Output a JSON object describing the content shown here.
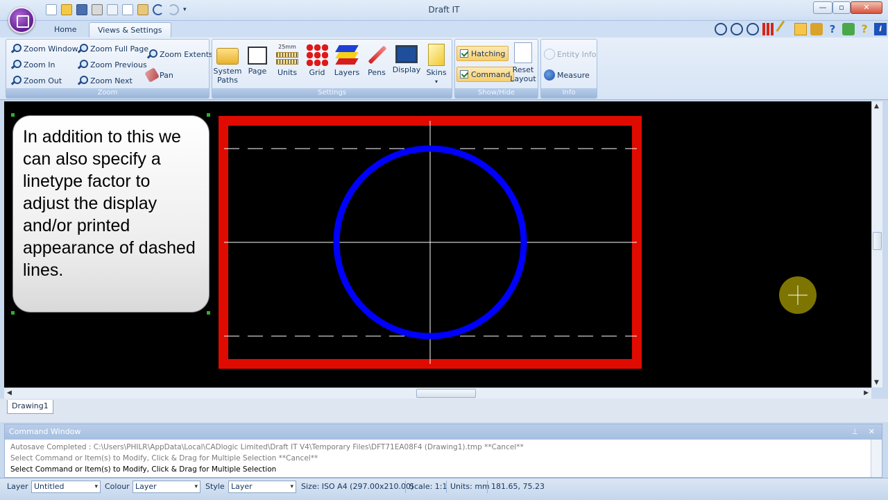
{
  "window": {
    "title": "Draft IT",
    "min_label": "—",
    "max_label": "▫",
    "close_label": "✕"
  },
  "tabs": [
    {
      "label": "Home"
    },
    {
      "label": "Views & Settings"
    }
  ],
  "ribbon": {
    "zoom": {
      "label": "Zoom",
      "zoom_window": "Zoom Window",
      "zoom_in": "Zoom In",
      "zoom_out": "Zoom Out",
      "zoom_full_page": "Zoom Full Page",
      "zoom_previous": "Zoom Previous",
      "zoom_next": "Zoom Next",
      "zoom_extents": "Zoom Extents",
      "pan": "Pan"
    },
    "settings": {
      "label": "Settings",
      "system_paths_1": "System",
      "system_paths_2": "Paths",
      "page": "Page",
      "units": "Units",
      "units_icon_text": "25mm",
      "grid": "Grid",
      "layers": "Layers",
      "pens": "Pens",
      "display": "Display",
      "skins": "Skins"
    },
    "showhide": {
      "label": "Show/Hide",
      "hatching": "Hatching",
      "command": "Command",
      "reset_1": "Reset",
      "reset_2": "Layout"
    },
    "info": {
      "label": "Info",
      "entity_info": "Entity Info",
      "measure": "Measure"
    }
  },
  "callout": {
    "text": "In addition to this we can also specify a linetype factor to adjust the display and/or printed appearance of dashed lines."
  },
  "drawing": {
    "frame_color": "#e00b00",
    "circle_color": "#0000ff",
    "line_color": "#ffffff",
    "cursor_color": "#8c8200"
  },
  "doc_tabs": {
    "active": "Drawing1"
  },
  "command_window": {
    "title": "Command Window",
    "pin": "⊥",
    "close": "✕",
    "lines": [
      "Autosave Completed : C:\\Users\\PHILR\\AppData\\Local\\CADlogic Limited\\Draft IT V4\\Temporary Files\\DFT71EA08F4 (Drawing1).tmp **Cancel**",
      "Select Command or Item(s) to Modify, Click & Drag for Multiple Selection  **Cancel**",
      "Select Command or Item(s) to Modify, Click & Drag for Multiple Selection"
    ]
  },
  "status": {
    "layer_label": "Layer",
    "layer_value": "Untitled",
    "colour_label": "Colour",
    "colour_value": "Layer",
    "style_label": "Style",
    "style_value": "Layer",
    "size": "Size: ISO A4 (297.00x210.00)",
    "scale": "Scale: 1:1",
    "units": "Units: mm",
    "coords": "181.65, 75.23"
  }
}
